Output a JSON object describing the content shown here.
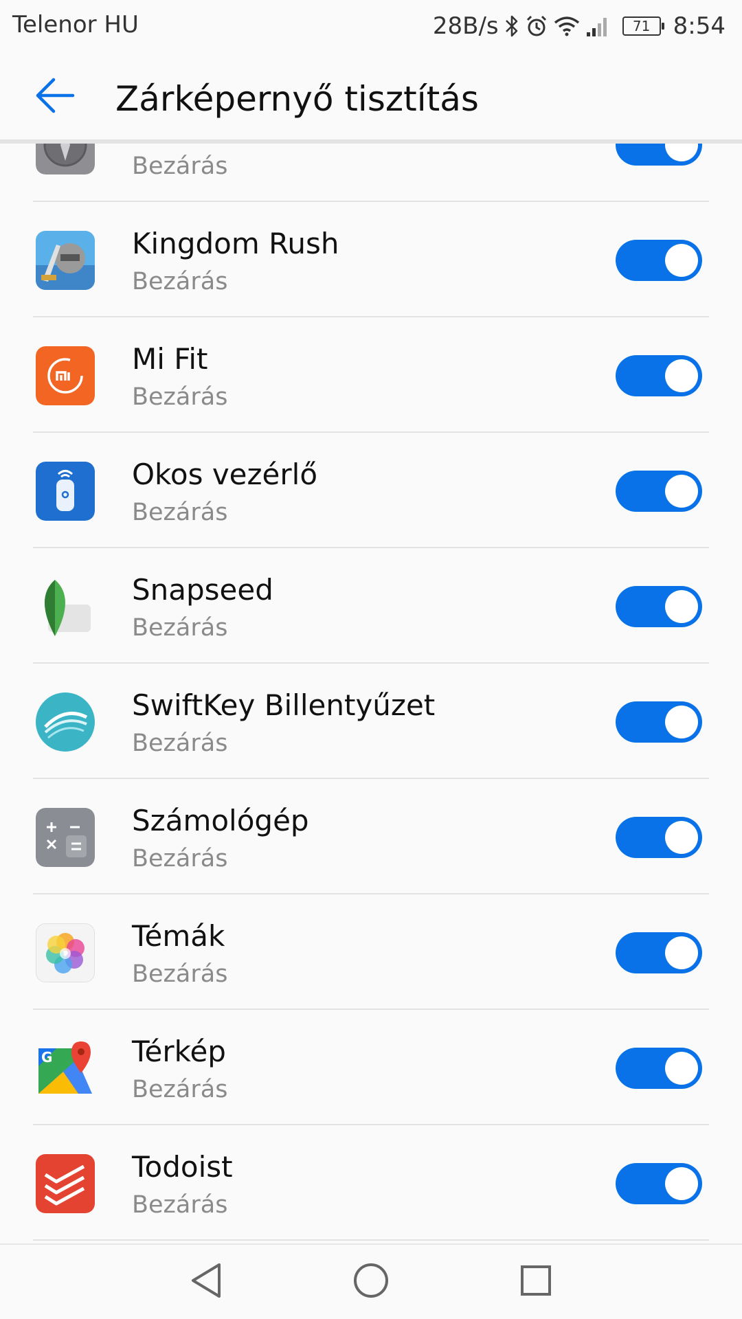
{
  "status_bar": {
    "carrier": "Telenor HU",
    "net_speed": "28B/s",
    "battery": "71",
    "time": "8:54",
    "icons": [
      "bluetooth-icon",
      "alarm-icon",
      "wifi-icon",
      "signal-icon",
      "battery-icon"
    ]
  },
  "header": {
    "title": "Zárképernyő tisztítás",
    "back_icon": "back-arrow-icon"
  },
  "colors": {
    "accent": "#0a72e8",
    "toggle_knob": "#ffffff",
    "secondary_text": "#8a8a8a"
  },
  "apps": [
    {
      "name": "",
      "subtitle": "Bezárás",
      "icon": "compass-icon",
      "enabled": true
    },
    {
      "name": "Kingdom Rush",
      "subtitle": "Bezárás",
      "icon": "kingdom-rush-icon",
      "enabled": true
    },
    {
      "name": "Mi Fit",
      "subtitle": "Bezárás",
      "icon": "mi-fit-icon",
      "enabled": true
    },
    {
      "name": "Okos vezérlő",
      "subtitle": "Bezárás",
      "icon": "smart-remote-icon",
      "enabled": true
    },
    {
      "name": "Snapseed",
      "subtitle": "Bezárás",
      "icon": "snapseed-icon",
      "enabled": true
    },
    {
      "name": "SwiftKey Billentyűzet",
      "subtitle": "Bezárás",
      "icon": "swiftkey-icon",
      "enabled": true
    },
    {
      "name": "Számológép",
      "subtitle": "Bezárás",
      "icon": "calculator-icon",
      "enabled": true
    },
    {
      "name": "Témák",
      "subtitle": "Bezárás",
      "icon": "themes-icon",
      "enabled": true
    },
    {
      "name": "Térkép",
      "subtitle": "Bezárás",
      "icon": "maps-icon",
      "enabled": true
    },
    {
      "name": "Todoist",
      "subtitle": "Bezárás",
      "icon": "todoist-icon",
      "enabled": true
    }
  ],
  "nav_bar": {
    "icons": [
      "nav-back-icon",
      "nav-home-icon",
      "nav-recents-icon"
    ]
  }
}
